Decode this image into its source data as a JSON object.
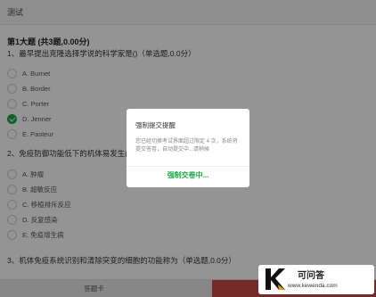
{
  "window": {
    "title": "测试"
  },
  "section": {
    "title": "第1大题 (共3题,0.00分)"
  },
  "questions": [
    {
      "text": "1、最早提出克隆选择学说的科学家是()（单选题,0.0分）",
      "options": [
        "A. Burnet",
        "B. Border",
        "C. Porter",
        "D. Jenner",
        "E. Pasteur"
      ],
      "selected": "D. Jenner"
    },
    {
      "text": "2、免疫防御功能低下的机体易发生()（",
      "options": [
        "A. 肿瘤",
        "B. 超敏反应",
        "C. 移植排斥反应",
        "D. 反复感染",
        "E. 免疫增生病"
      ]
    },
    {
      "text": "3、机体免疫系统识别和清除突变的细胞的功能称为（单选题,0.0分）"
    }
  ],
  "modal": {
    "title": "强制提交提醒",
    "body": "您已经切换考试界面超过限定 4 次，系统将提交答卷，自动提交中...请稍候",
    "action": "强制交卷中..."
  },
  "bottom_bar": {
    "answer_card": "答题卡"
  },
  "watermark": {
    "name": "可问答",
    "url": "www.kewenda.com"
  },
  "colors": {
    "accent": "#19a84a",
    "submit": "#c94a45"
  }
}
